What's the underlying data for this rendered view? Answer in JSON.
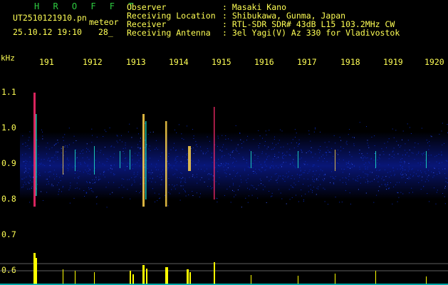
{
  "header": {
    "app_name": "H R O F F T",
    "file_name": "UT2510121910.pn",
    "meteor_label": "meteor",
    "datetime": "25.10.12 19:10",
    "count": "28_"
  },
  "info": {
    "labels": [
      "Observer",
      "Receiving Location",
      "Receiver",
      "Receiving Antenna"
    ],
    "values": [
      ": Masaki Kano",
      ": Shibukawa, Gunma, Japan",
      ": RTL-SDR SDR# 43dB L15 103.2MHz CW",
      ": 3el Yagi(V) Az 330 for Vladivostok"
    ]
  },
  "axes": {
    "y_unit": "kHz",
    "y_ticks": [
      "1.1",
      "1.0",
      "0.9",
      "0.8",
      "0.7",
      "0.6"
    ],
    "x_ticks": [
      "191",
      "1912",
      "1913",
      "1914",
      "1915",
      "1916",
      "1917",
      "1918",
      "1919",
      "1920"
    ]
  },
  "colors": {
    "background": "#000000",
    "text": "#ffff55",
    "title": "#2ecc40",
    "noise": "#0a1a8c",
    "signal_hot": "#ff2a6d",
    "signal_warm": "#ffd24a",
    "signal_cool": "#1ee6c8",
    "bars": "#ffff00",
    "baseline": "#00e0e0"
  }
}
